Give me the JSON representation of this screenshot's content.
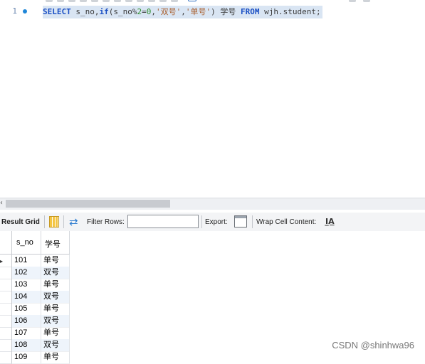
{
  "editor": {
    "line_number": "1",
    "code": {
      "kw_select": "SELECT",
      "t1": " s_no,",
      "kw_if": "if",
      "t2": "(s_no%",
      "n2": "2",
      "t3": "=",
      "n0": "0",
      "t4": ",",
      "s1": "'双号'",
      "t5": ",",
      "s2": "'单号'",
      "t6": ") 学号 ",
      "kw_from": "FROM",
      "t7": " wjh.student;"
    }
  },
  "result_toolbar": {
    "result_grid_label": "Result Grid",
    "filter_label": "Filter Rows:",
    "filter_value": "",
    "export_label": "Export:",
    "wrap_label": "Wrap Cell Content:",
    "wrap_icon_glyph": "I̲A"
  },
  "grid": {
    "columns": [
      "s_no",
      "学号"
    ],
    "rows": [
      [
        "101",
        "单号"
      ],
      [
        "102",
        "双号"
      ],
      [
        "103",
        "单号"
      ],
      [
        "104",
        "双号"
      ],
      [
        "105",
        "单号"
      ],
      [
        "106",
        "双号"
      ],
      [
        "107",
        "单号"
      ],
      [
        "108",
        "双号"
      ],
      [
        "109",
        "单号"
      ]
    ]
  },
  "watermark": "CSDN @shinhwa96",
  "colors": {
    "selection": "#d9e5f3",
    "keyword": "#1a4fc4",
    "string": "#a85d2b",
    "alt_row": "#eef4fb"
  }
}
